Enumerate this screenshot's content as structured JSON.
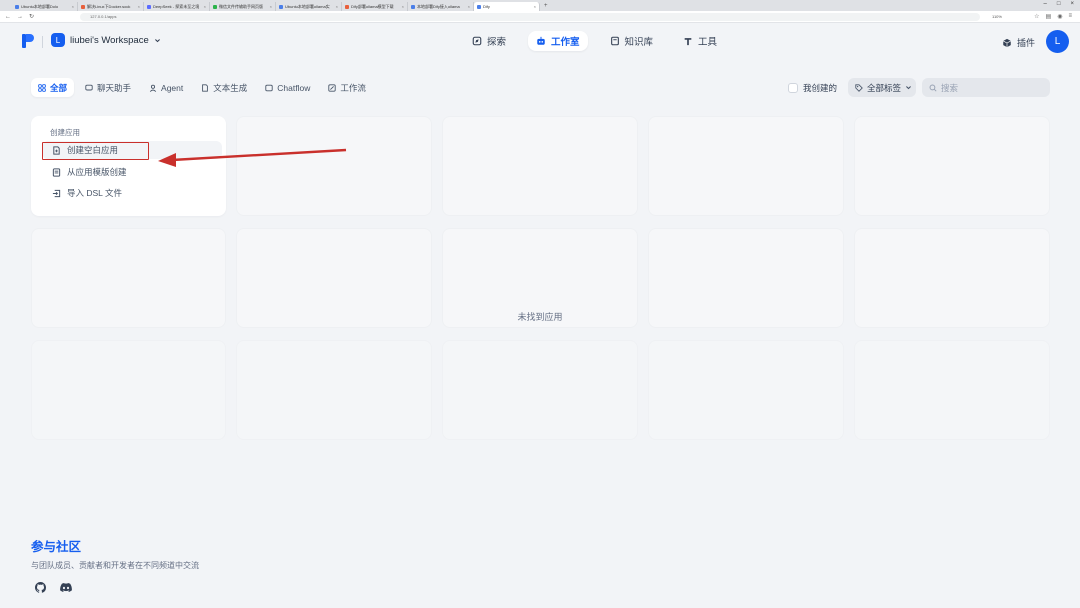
{
  "browser": {
    "tabs": [
      {
        "title": "Ubuntu本地部署Dolo",
        "active": false
      },
      {
        "title": "解决Linux下Docker.sock",
        "active": false
      },
      {
        "title": "DeepSeek - 探索未至之境",
        "active": false
      },
      {
        "title": "微信文件传输助手网页版",
        "active": false
      },
      {
        "title": "Ubuntu本地部署ollama实",
        "active": false
      },
      {
        "title": "Dify部署ollama模型下载",
        "active": false
      },
      {
        "title": "本地部署Dify接入ollama",
        "active": false
      },
      {
        "title": "Dify",
        "active": true
      }
    ],
    "new_tab": "+",
    "url": "127.0.0.1/apps",
    "zoom": "110%",
    "window_controls": [
      "–",
      "□",
      "×"
    ]
  },
  "header": {
    "workspace_initial": "L",
    "workspace_name": "liubei's Workspace",
    "nav": [
      {
        "label": "探索",
        "icon": "compass-icon",
        "active": false
      },
      {
        "label": "工作室",
        "icon": "robot-icon",
        "active": true
      },
      {
        "label": "知识库",
        "icon": "book-icon",
        "active": false
      },
      {
        "label": "工具",
        "icon": "hammer-icon",
        "active": false
      }
    ],
    "plugin_label": "插件",
    "user_initial": "L"
  },
  "filters": {
    "tabs": [
      {
        "label": "全部",
        "active": true
      },
      {
        "label": "聊天助手",
        "active": false
      },
      {
        "label": "Agent",
        "active": false
      },
      {
        "label": "文本生成",
        "active": false
      },
      {
        "label": "Chatflow",
        "active": false
      },
      {
        "label": "工作流",
        "active": false
      }
    ],
    "mine_label": "我创建的",
    "tags_label": "全部标签",
    "search_placeholder": "搜索"
  },
  "create": {
    "title": "创建应用",
    "items": [
      {
        "label": "创建空白应用"
      },
      {
        "label": "从应用模版创建"
      },
      {
        "label": "导入 DSL 文件"
      }
    ]
  },
  "empty_message": "未找到应用",
  "community": {
    "title": "参与社区",
    "description": "与团队成员、贡献者和开发者在不同频道中交流"
  },
  "colors": {
    "accent": "#155eef",
    "annotation": "#c9302c",
    "background": "#f2f4f7"
  }
}
